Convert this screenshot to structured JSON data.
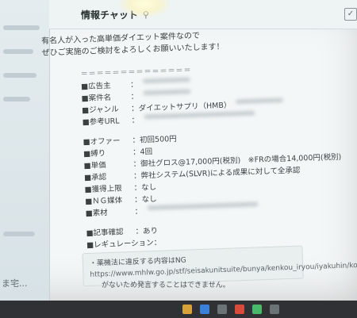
{
  "channel": {
    "title": "情報チャット",
    "pin_icon": "pin-icon"
  },
  "sidebar": {
    "tail_text": "ま宅..."
  },
  "message": {
    "intro_line1": "有名人が入った高単価ダイエット案件なので",
    "intro_line2": "ぜひご実施のご検討をよろしくお願いいたします！",
    "divider": "＝＝＝＝＝＝＝＝＝＝＝＝＝＝",
    "specs_top": [
      {
        "label": "■広告主",
        "value": "："
      },
      {
        "label": "■案件名",
        "value": "："
      },
      {
        "label": "■ジャンル",
        "value": "：ダイエットサプリ（HMB）"
      },
      {
        "label": "■参考URL",
        "value": "："
      }
    ],
    "specs_mid": [
      {
        "label": "■オファー",
        "value": "：初回500円"
      },
      {
        "label": "■縛り",
        "value": "：4回"
      },
      {
        "label": "■単価",
        "value": "：御社グロス@17,000円(税別)　※FRの場合14,000円(税別)"
      },
      {
        "label": "■承認",
        "value": "：弊社システム(SLVR)による成果に対して全承認"
      },
      {
        "label": "■獲得上限",
        "value": "：なし"
      },
      {
        "label": "■ＮＧ媒体",
        "value": "：なし"
      },
      {
        "label": "■素材",
        "value": "："
      }
    ],
    "specs_bottom": [
      {
        "label": "■記事確認",
        "value": "：あり"
      },
      {
        "label": "■レギュレーション",
        "value": "："
      }
    ],
    "regulation": {
      "line1": "・薬機法に違反する内容はNG",
      "url": "https://www.mhlw.go.jp/stf/seisakunitsuite/bunya/kenkou_iryou/iyakuhin/koukokukisei/index.html"
    },
    "footer_note": "がないため発言することはできません。"
  },
  "colors": {
    "screen_bg": "#f4f7f7",
    "text": "#3b4041",
    "taskbar": "#2f3134"
  }
}
